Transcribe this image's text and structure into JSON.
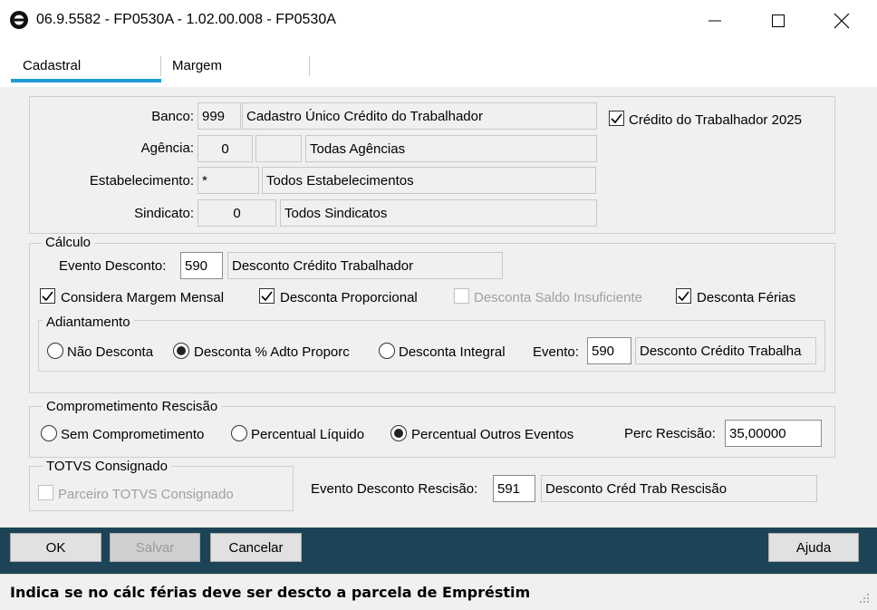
{
  "window": {
    "title": "06.9.5582 - FP0530A - 1.02.00.008 - FP0530A",
    "minimize_glyph": "—",
    "maximize_glyph": "☐",
    "close_glyph": "✕"
  },
  "tabs": [
    {
      "label": "Cadastral",
      "active": true
    },
    {
      "label": "Margem",
      "active": false
    }
  ],
  "cadastro": {
    "banco_label": "Banco:",
    "banco_code": "999",
    "banco_desc": "Cadastro  Único  Crédito do Trabalhador",
    "credito_2025_label": "Crédito do Trabalhador 2025",
    "credito_2025_checked": true,
    "agencia_label": "Agência:",
    "agencia_code": "0",
    "agencia_digit": "",
    "agencia_desc": "Todas Agências",
    "estab_label": "Estabelecimento:",
    "estab_code": "*",
    "estab_desc": "Todos Estabelecimentos",
    "sindicato_label": "Sindicato:",
    "sindicato_code": "0",
    "sindicato_desc": "Todos Sindicatos"
  },
  "calculo": {
    "legend": "Cálculo",
    "evento_label": "Evento Desconto:",
    "evento_code": "590",
    "evento_desc": "Desconto Crédito Trabalhador",
    "checks": [
      {
        "label": "Considera Margem Mensal",
        "checked": true,
        "enabled": true
      },
      {
        "label": "Desconta Proporcional",
        "checked": true,
        "enabled": true
      },
      {
        "label": "Desconta Saldo Insuficiente",
        "checked": false,
        "enabled": false
      },
      {
        "label": "Desconta Férias",
        "checked": true,
        "enabled": true
      }
    ],
    "adiantamento": {
      "legend": "Adiantamento",
      "options": [
        {
          "label": "Não Desconta",
          "selected": false
        },
        {
          "label": "Desconta % Adto Proporc",
          "selected": true
        },
        {
          "label": "Desconta Integral",
          "selected": false
        }
      ],
      "evento_label": "Evento:",
      "evento_code": "590",
      "evento_desc": "Desconto Crédito Trabalha"
    }
  },
  "rescisao": {
    "legend": "Comprometimento Rescisão",
    "options": [
      {
        "label": "Sem Comprometimento",
        "selected": false
      },
      {
        "label": "Percentual Líquido",
        "selected": false
      },
      {
        "label": "Percentual Outros Eventos",
        "selected": true
      }
    ],
    "perc_label": "Perc Rescisão:",
    "perc_value": "35,00000"
  },
  "consignado": {
    "legend": "TOTVS Consignado",
    "parceiro_label": "Parceiro TOTVS Consignado",
    "parceiro_checked": false,
    "evento_label": "Evento Desconto Rescisão:",
    "evento_code": "591",
    "evento_desc": "Desconto Créd Trab Rescisão"
  },
  "buttons": {
    "ok": "OK",
    "salvar": "Salvar",
    "cancelar": "Cancelar",
    "ajuda": "Ajuda"
  },
  "status": {
    "text": "Indica se no cálc férias deve ser descto a parcela de Empréstim"
  },
  "colors": {
    "tab_accent": "#1e9bd7",
    "button_bar": "#1d4456"
  }
}
